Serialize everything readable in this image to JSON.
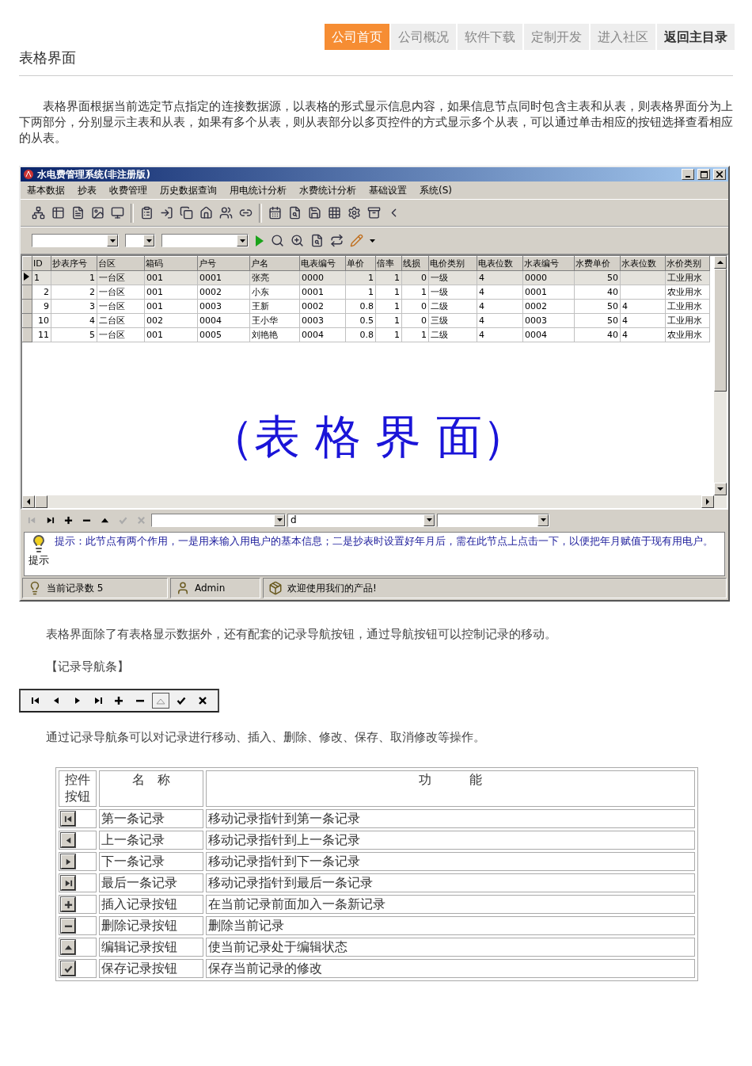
{
  "site_nav": [
    {
      "label": "公司首页",
      "kind": "tab",
      "selected": true
    },
    {
      "label": "公司概况",
      "kind": "tab",
      "selected": false
    },
    {
      "label": "软件下载",
      "kind": "tab",
      "selected": false
    },
    {
      "label": "定制开发",
      "kind": "tab",
      "selected": false
    },
    {
      "label": "进入社区",
      "kind": "tab",
      "selected": false
    },
    {
      "label": "返回主目录",
      "kind": "back",
      "selected": false
    }
  ],
  "page_title": "表格界面",
  "intro": "表格界面根据当前选定节点指定的连接数据源，以表格的形式显示信息内容，如果信息节点同时包含主表和从表，则表格界面分为上下两部分，分别显示主表和从表，如果有多个从表，则从表部分以多页控件的方式显示多个从表，可以通过单击相应的按钮选择查看相应的从表。",
  "app": {
    "title": "水电费管理系统(非注册版)",
    "menu": [
      "基本数据",
      "抄表",
      "收费管理",
      "历史数据查询",
      "用电统计分析",
      "水费统计分析",
      "基础设置",
      "系统(S)"
    ],
    "grid": {
      "columns": [
        {
          "label": "ID",
          "numeric": true
        },
        {
          "label": "抄表序号",
          "numeric": true
        },
        {
          "label": "台区",
          "numeric": false
        },
        {
          "label": "箱码",
          "numeric": false
        },
        {
          "label": "户号",
          "numeric": false
        },
        {
          "label": "户名",
          "numeric": false
        },
        {
          "label": "电表编号",
          "numeric": false
        },
        {
          "label": "单价",
          "numeric": true
        },
        {
          "label": "倍率",
          "numeric": true
        },
        {
          "label": "线损",
          "numeric": true
        },
        {
          "label": "电价类别",
          "numeric": false
        },
        {
          "label": "电表位数",
          "numeric": false
        },
        {
          "label": "水表编号",
          "numeric": false
        },
        {
          "label": "水费单价",
          "numeric": true
        },
        {
          "label": "水表位数",
          "numeric": false
        },
        {
          "label": "水价类别",
          "numeric": false
        }
      ],
      "rows": [
        {
          "selected": true,
          "cells": [
            "1",
            "1",
            "一台区",
            "001",
            "0001",
            "张亮",
            "0000",
            "1",
            "1",
            "0",
            "一级",
            "4",
            "0000",
            "50",
            "",
            "工业用水"
          ]
        },
        {
          "selected": false,
          "cells": [
            "2",
            "2",
            "一台区",
            "001",
            "0002",
            "小东",
            "0001",
            "1",
            "1",
            "1",
            "一级",
            "4",
            "0001",
            "40",
            "",
            "农业用水"
          ]
        },
        {
          "selected": false,
          "cells": [
            "9",
            "3",
            "一台区",
            "001",
            "0003",
            "王新",
            "0002",
            "0.8",
            "1",
            "0",
            "二级",
            "4",
            "0002",
            "50",
            "4",
            "工业用水"
          ]
        },
        {
          "selected": false,
          "cells": [
            "10",
            "4",
            "二台区",
            "002",
            "0004",
            "王小华",
            "0003",
            "0.5",
            "1",
            "0",
            "三级",
            "4",
            "0003",
            "50",
            "4",
            "工业用水"
          ]
        },
        {
          "selected": false,
          "cells": [
            "11",
            "5",
            "一台区",
            "001",
            "0005",
            "刘艳艳",
            "0004",
            "0.8",
            "1",
            "1",
            "二级",
            "4",
            "0004",
            "40",
            "4",
            "农业用水"
          ]
        }
      ],
      "overlay_text": "（表 格 界 面）"
    },
    "nav_buttons": [
      {
        "kind": "first",
        "disabled": true
      },
      {
        "kind": "last",
        "disabled": false
      },
      {
        "kind": "insert",
        "disabled": false
      },
      {
        "kind": "delete",
        "disabled": false
      },
      {
        "kind": "edit",
        "disabled": false
      },
      {
        "kind": "post",
        "disabled": true
      },
      {
        "kind": "cancel",
        "disabled": true
      }
    ],
    "fields": [
      {
        "kind": "combo"
      },
      {
        "kind": "combo",
        "value": "d"
      },
      {
        "kind": "combo"
      }
    ],
    "hint": {
      "label": "提示",
      "text": "提示：此节点有两个作用，一是用来输入用电户的基本信息；二是抄表时设置好年月后，需在此节点上点击一下，以便把年月赋值于现有用电户。"
    },
    "status": [
      {
        "kind": "records",
        "text": "当前记录数 5"
      },
      {
        "kind": "user",
        "text": "Admin"
      },
      {
        "kind": "welcome",
        "text": "欢迎使用我们的产品!"
      }
    ]
  },
  "para2": "表格界面除了有表格显示数据外，还有配套的记录导航按钮，通过导航按钮可以控制记录的移动。",
  "nav_caption": "【记录导航条】",
  "nav_bar": [
    {
      "kind": "first",
      "pressed": false
    },
    {
      "kind": "prev",
      "pressed": false
    },
    {
      "kind": "next",
      "pressed": false
    },
    {
      "kind": "last",
      "pressed": false
    },
    {
      "kind": "insert",
      "pressed": false
    },
    {
      "kind": "delete",
      "pressed": false
    },
    {
      "kind": "edit",
      "pressed": true
    },
    {
      "kind": "post",
      "pressed": false
    },
    {
      "kind": "cancel",
      "pressed": false
    }
  ],
  "para3": "通过记录导航条可以对记录进行移动、插入、删除、修改、保存、取消修改等操作。",
  "table": {
    "headers": [
      "控件按钮",
      "名　称",
      "功　　　能"
    ],
    "rows": [
      {
        "kind": "first",
        "name": "第一条记录",
        "function": "移动记录指针到第一条记录"
      },
      {
        "kind": "prev",
        "name": "上一条记录",
        "function": "移动记录指针到上一条记录"
      },
      {
        "kind": "next",
        "name": "下一条记录",
        "function": "移动记录指针到下一条记录"
      },
      {
        "kind": "last",
        "name": "最后一条记录",
        "function": "移动记录指针到最后一条记录"
      },
      {
        "kind": "insert",
        "name": "插入记录按钮",
        "function": "在当前记录前面加入一条新记录"
      },
      {
        "kind": "delete",
        "name": "删除记录按钮",
        "function": "删除当前记录"
      },
      {
        "kind": "edit",
        "name": "编辑记录按钮",
        "function": "使当前记录处于编辑状态"
      },
      {
        "kind": "post",
        "name": "保存记录按钮",
        "function": "保存当前记录的修改"
      }
    ]
  }
}
